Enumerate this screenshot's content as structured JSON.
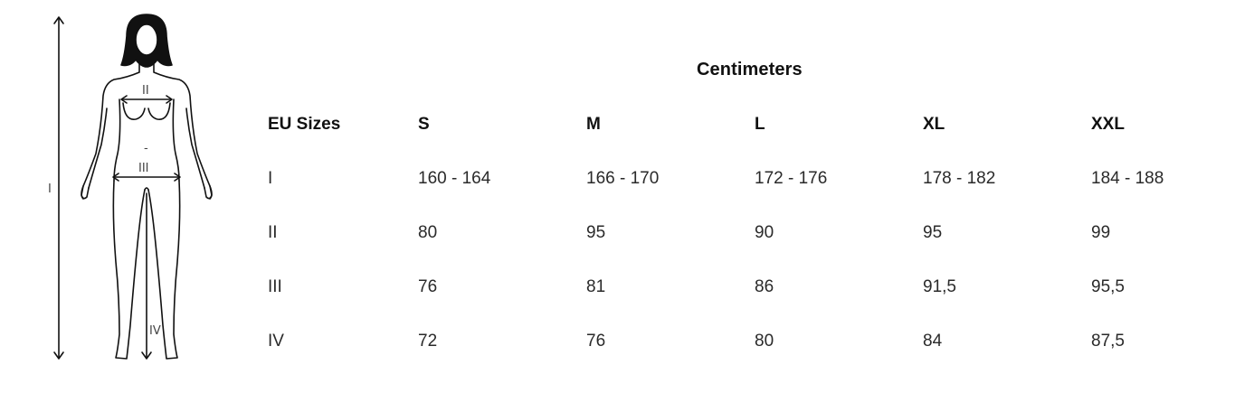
{
  "figure": {
    "labels": {
      "height": "I",
      "bust": "II",
      "waist_marker": "-",
      "hips": "III",
      "inseam": "IV"
    }
  },
  "table": {
    "title": "Centimeters",
    "header": [
      "EU Sizes",
      "S",
      "M",
      "L",
      "XL",
      "XXL"
    ],
    "rows": [
      [
        "I",
        "160 - 164",
        "166 - 170",
        "172 - 176",
        "178 - 182",
        "184 - 188"
      ],
      [
        "II",
        "80",
        "95",
        "90",
        "95",
        "99"
      ],
      [
        "III",
        "76",
        "81",
        "86",
        "91,5",
        "95,5"
      ],
      [
        "IV",
        "72",
        "76",
        "80",
        "84",
        "87,5"
      ]
    ]
  }
}
